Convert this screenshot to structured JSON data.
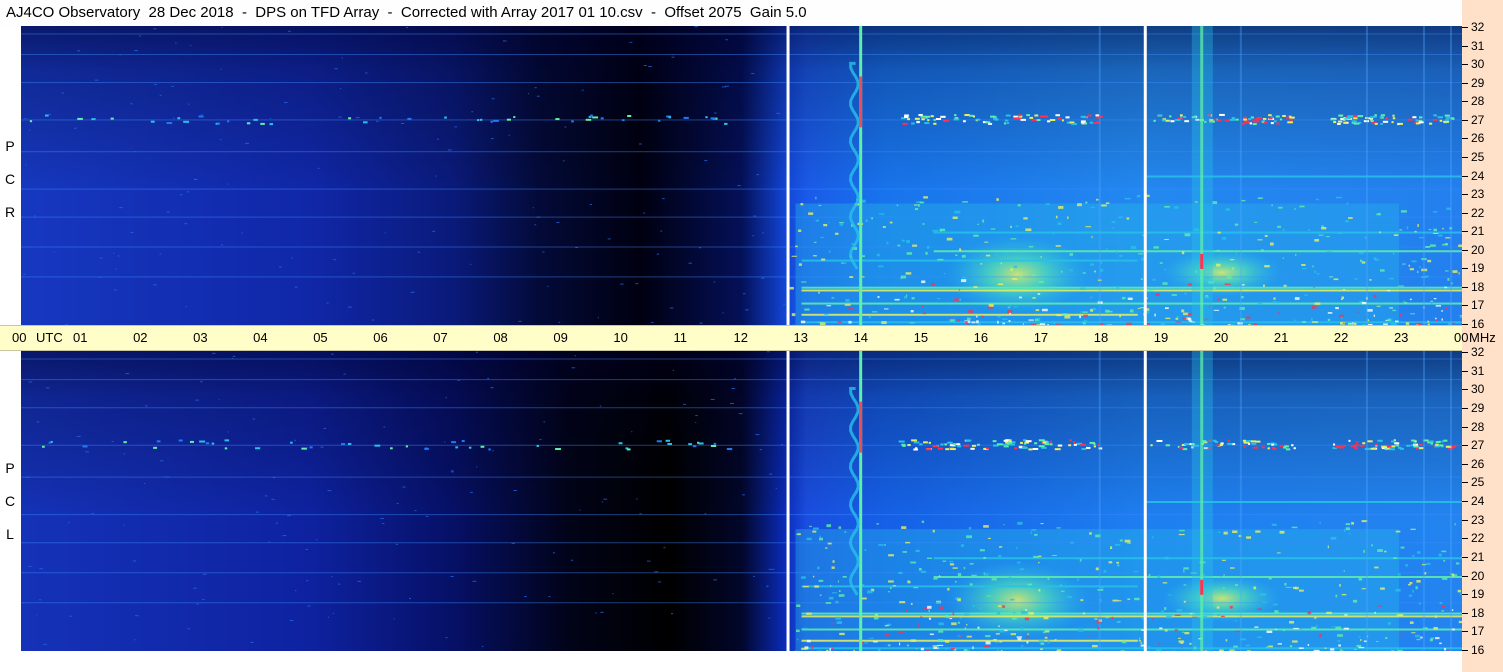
{
  "header": {
    "title": "AJ4CO Observatory  28 Dec 2018  -  DPS on TFD Array  -  Corrected with Array 2017 01 10.csv  -  Offset 2075  Gain 5.0"
  },
  "panels": [
    {
      "id": "rcp",
      "label_letters": [
        "R",
        "C",
        "P"
      ]
    },
    {
      "id": "lcp",
      "label_letters": [
        "L",
        "C",
        "P"
      ]
    }
  ],
  "time_axis": {
    "labels": [
      "00",
      "UTC",
      "01",
      "02",
      "03",
      "04",
      "05",
      "06",
      "07",
      "08",
      "09",
      "10",
      "11",
      "12",
      "13",
      "14",
      "15",
      "16",
      "17",
      "18",
      "19",
      "20",
      "21",
      "22",
      "23",
      "00",
      "MHz"
    ]
  },
  "chart_data": {
    "type": "heatmap",
    "title": "AJ4CO Observatory  28 Dec 2018  -  DPS on TFD Array  -  Corrected with Array 2017 01 10.csv  -  Offset 2075  Gain 5.0",
    "x_unit": "UTC hours",
    "x_ticks": [
      "00",
      "01",
      "02",
      "03",
      "04",
      "05",
      "06",
      "07",
      "08",
      "09",
      "10",
      "11",
      "12",
      "13",
      "14",
      "15",
      "16",
      "17",
      "18",
      "19",
      "20",
      "21",
      "22",
      "23",
      "00"
    ],
    "xlim": [
      0,
      24
    ],
    "y_unit": "MHz",
    "y_ticks": [
      32,
      31,
      30,
      29,
      28,
      27,
      26,
      25,
      24,
      23,
      22,
      21,
      20,
      19,
      18,
      17,
      16
    ],
    "ylim": [
      16,
      32
    ],
    "panels": [
      "RCP",
      "LCP"
    ],
    "colormap": [
      "#000000",
      "#001a8c",
      "#0a3ad6",
      "#1f7af5",
      "#27c2e8",
      "#5ff0a8",
      "#e8f060",
      "#ff3050",
      "#ffffff"
    ],
    "data_gaps_utc": [
      12.75,
      18.7
    ],
    "vertical_events_utc": [
      14.0,
      19.67
    ],
    "horizontal_features_mhz": [
      27.0,
      18.0,
      17.0,
      21.0,
      20.0
    ]
  }
}
